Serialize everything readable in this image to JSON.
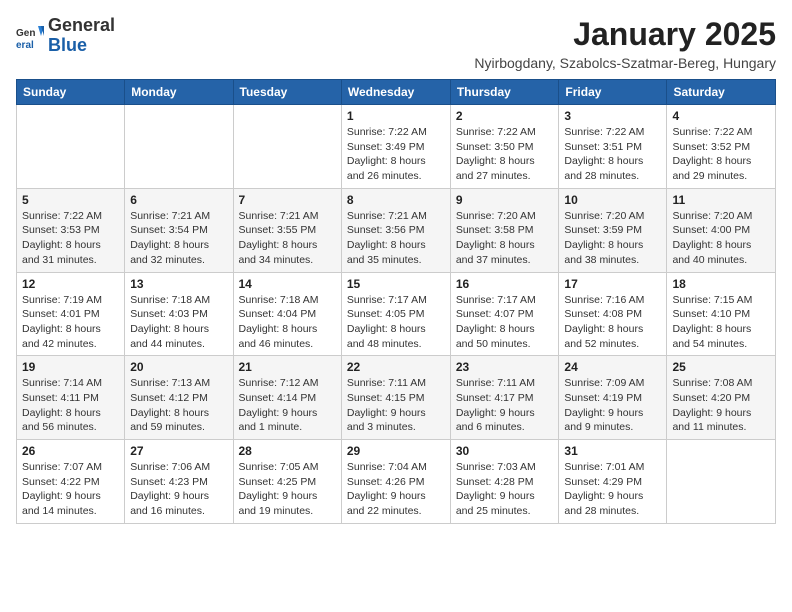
{
  "logo": {
    "general": "General",
    "blue": "Blue"
  },
  "title": "January 2025",
  "subtitle": "Nyirbogdany, Szabolcs-Szatmar-Bereg, Hungary",
  "days_of_week": [
    "Sunday",
    "Monday",
    "Tuesday",
    "Wednesday",
    "Thursday",
    "Friday",
    "Saturday"
  ],
  "weeks": [
    [
      {
        "day": "",
        "info": ""
      },
      {
        "day": "",
        "info": ""
      },
      {
        "day": "",
        "info": ""
      },
      {
        "day": "1",
        "info": "Sunrise: 7:22 AM\nSunset: 3:49 PM\nDaylight: 8 hours and 26 minutes."
      },
      {
        "day": "2",
        "info": "Sunrise: 7:22 AM\nSunset: 3:50 PM\nDaylight: 8 hours and 27 minutes."
      },
      {
        "day": "3",
        "info": "Sunrise: 7:22 AM\nSunset: 3:51 PM\nDaylight: 8 hours and 28 minutes."
      },
      {
        "day": "4",
        "info": "Sunrise: 7:22 AM\nSunset: 3:52 PM\nDaylight: 8 hours and 29 minutes."
      }
    ],
    [
      {
        "day": "5",
        "info": "Sunrise: 7:22 AM\nSunset: 3:53 PM\nDaylight: 8 hours and 31 minutes."
      },
      {
        "day": "6",
        "info": "Sunrise: 7:21 AM\nSunset: 3:54 PM\nDaylight: 8 hours and 32 minutes."
      },
      {
        "day": "7",
        "info": "Sunrise: 7:21 AM\nSunset: 3:55 PM\nDaylight: 8 hours and 34 minutes."
      },
      {
        "day": "8",
        "info": "Sunrise: 7:21 AM\nSunset: 3:56 PM\nDaylight: 8 hours and 35 minutes."
      },
      {
        "day": "9",
        "info": "Sunrise: 7:20 AM\nSunset: 3:58 PM\nDaylight: 8 hours and 37 minutes."
      },
      {
        "day": "10",
        "info": "Sunrise: 7:20 AM\nSunset: 3:59 PM\nDaylight: 8 hours and 38 minutes."
      },
      {
        "day": "11",
        "info": "Sunrise: 7:20 AM\nSunset: 4:00 PM\nDaylight: 8 hours and 40 minutes."
      }
    ],
    [
      {
        "day": "12",
        "info": "Sunrise: 7:19 AM\nSunset: 4:01 PM\nDaylight: 8 hours and 42 minutes."
      },
      {
        "day": "13",
        "info": "Sunrise: 7:18 AM\nSunset: 4:03 PM\nDaylight: 8 hours and 44 minutes."
      },
      {
        "day": "14",
        "info": "Sunrise: 7:18 AM\nSunset: 4:04 PM\nDaylight: 8 hours and 46 minutes."
      },
      {
        "day": "15",
        "info": "Sunrise: 7:17 AM\nSunset: 4:05 PM\nDaylight: 8 hours and 48 minutes."
      },
      {
        "day": "16",
        "info": "Sunrise: 7:17 AM\nSunset: 4:07 PM\nDaylight: 8 hours and 50 minutes."
      },
      {
        "day": "17",
        "info": "Sunrise: 7:16 AM\nSunset: 4:08 PM\nDaylight: 8 hours and 52 minutes."
      },
      {
        "day": "18",
        "info": "Sunrise: 7:15 AM\nSunset: 4:10 PM\nDaylight: 8 hours and 54 minutes."
      }
    ],
    [
      {
        "day": "19",
        "info": "Sunrise: 7:14 AM\nSunset: 4:11 PM\nDaylight: 8 hours and 56 minutes."
      },
      {
        "day": "20",
        "info": "Sunrise: 7:13 AM\nSunset: 4:12 PM\nDaylight: 8 hours and 59 minutes."
      },
      {
        "day": "21",
        "info": "Sunrise: 7:12 AM\nSunset: 4:14 PM\nDaylight: 9 hours and 1 minute."
      },
      {
        "day": "22",
        "info": "Sunrise: 7:11 AM\nSunset: 4:15 PM\nDaylight: 9 hours and 3 minutes."
      },
      {
        "day": "23",
        "info": "Sunrise: 7:11 AM\nSunset: 4:17 PM\nDaylight: 9 hours and 6 minutes."
      },
      {
        "day": "24",
        "info": "Sunrise: 7:09 AM\nSunset: 4:19 PM\nDaylight: 9 hours and 9 minutes."
      },
      {
        "day": "25",
        "info": "Sunrise: 7:08 AM\nSunset: 4:20 PM\nDaylight: 9 hours and 11 minutes."
      }
    ],
    [
      {
        "day": "26",
        "info": "Sunrise: 7:07 AM\nSunset: 4:22 PM\nDaylight: 9 hours and 14 minutes."
      },
      {
        "day": "27",
        "info": "Sunrise: 7:06 AM\nSunset: 4:23 PM\nDaylight: 9 hours and 16 minutes."
      },
      {
        "day": "28",
        "info": "Sunrise: 7:05 AM\nSunset: 4:25 PM\nDaylight: 9 hours and 19 minutes."
      },
      {
        "day": "29",
        "info": "Sunrise: 7:04 AM\nSunset: 4:26 PM\nDaylight: 9 hours and 22 minutes."
      },
      {
        "day": "30",
        "info": "Sunrise: 7:03 AM\nSunset: 4:28 PM\nDaylight: 9 hours and 25 minutes."
      },
      {
        "day": "31",
        "info": "Sunrise: 7:01 AM\nSunset: 4:29 PM\nDaylight: 9 hours and 28 minutes."
      },
      {
        "day": "",
        "info": ""
      }
    ]
  ]
}
